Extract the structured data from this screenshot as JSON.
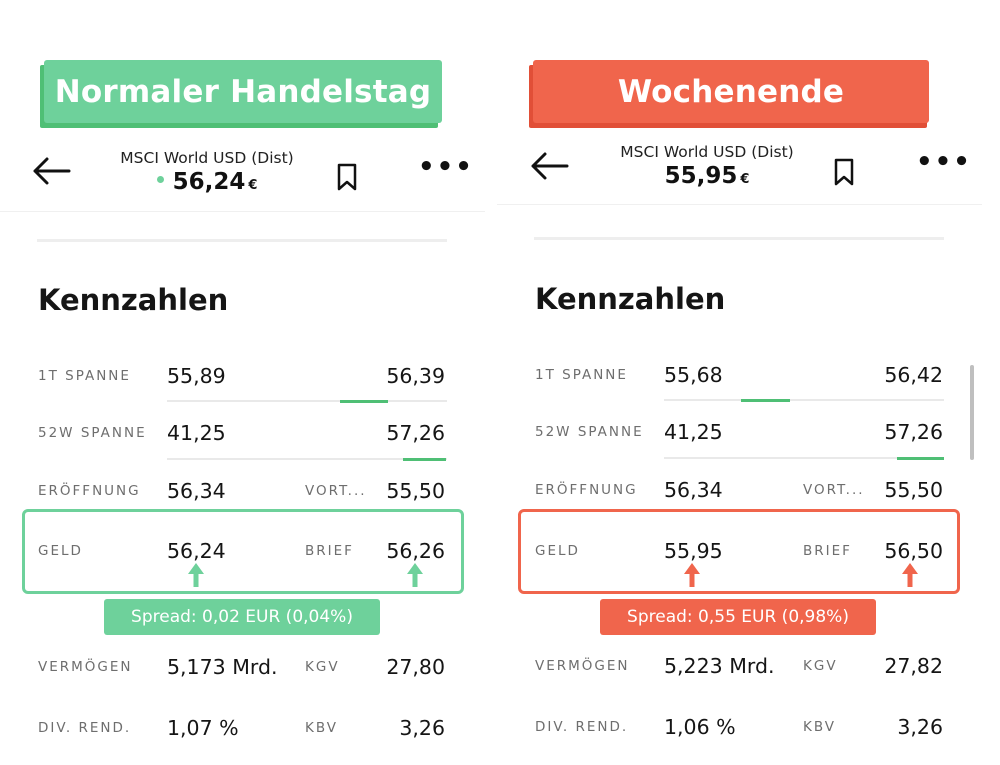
{
  "colors": {
    "green": "#6ed19b",
    "green_dark": "#4fbf75",
    "red": "#f0654c"
  },
  "left": {
    "badge": "Normaler Handelstag",
    "instrument": "MSCI World USD (Dist)",
    "price": "56,24",
    "currency": "€",
    "live_indicator": true,
    "section_title": "Kennzahlen",
    "rows": {
      "r1": {
        "label": "1T SPANNE",
        "low": "55,89",
        "high": "56,39"
      },
      "r2": {
        "label": "52W SPANNE",
        "low": "41,25",
        "high": "57,26"
      },
      "r3": {
        "label": "ERÖFFNUNG",
        "value": "56,34",
        "label2": "VORT...",
        "value2": "55,50"
      },
      "r4": {
        "label": "GELD",
        "value": "56,24",
        "label2": "BRIEF",
        "value2": "56,26"
      },
      "r5": {
        "label": "VERMÖGEN",
        "value": "5,173 Mrd.",
        "label2": "KGV",
        "value2": "27,80"
      },
      "r6": {
        "label": "DIV. REND.",
        "value": "1,07 %",
        "label2": "KBV",
        "value2": "3,26"
      }
    },
    "spread": "Spread: 0,02 EUR (0,04%)"
  },
  "right": {
    "badge": "Wochenende",
    "instrument": "MSCI World USD (Dist)",
    "price": "55,95",
    "currency": "€",
    "section_title": "Kennzahlen",
    "rows": {
      "r1": {
        "label": "1T SPANNE",
        "low": "55,68",
        "high": "56,42"
      },
      "r2": {
        "label": "52W SPANNE",
        "low": "41,25",
        "high": "57,26"
      },
      "r3": {
        "label": "ERÖFFNUNG",
        "value": "56,34",
        "label2": "VORT...",
        "value2": "55,50"
      },
      "r4": {
        "label": "GELD",
        "value": "55,95",
        "label2": "BRIEF",
        "value2": "56,50"
      },
      "r5": {
        "label": "VERMÖGEN",
        "value": "5,223 Mrd.",
        "label2": "KGV",
        "value2": "27,82"
      },
      "r6": {
        "label": "DIV. REND.",
        "value": "1,06 %",
        "label2": "KBV",
        "value2": "3,26"
      }
    },
    "spread": "Spread: 0,55 EUR (0,98%)"
  },
  "icons": [
    "back-arrow-icon",
    "bookmark-icon",
    "more-icon",
    "arrow-up-icon"
  ]
}
